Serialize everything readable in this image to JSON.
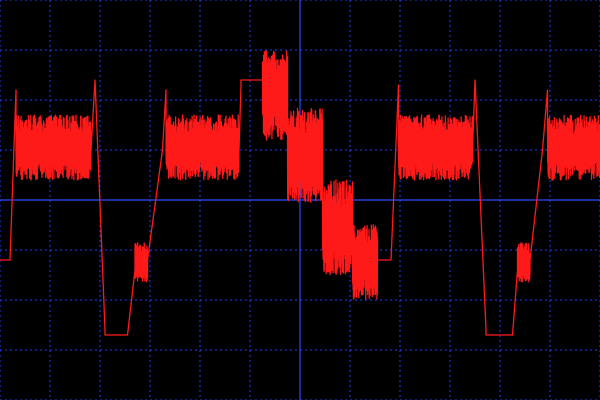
{
  "screen": {
    "background_color": "#000000",
    "grid_color": "#1f3fff",
    "axis_color": "#2a4bff",
    "trace_color": "#ff1a1a"
  },
  "chart_data": {
    "type": "line",
    "title": "",
    "xlabel": "",
    "ylabel": "",
    "grid": true,
    "grid_style": "dotted",
    "x_divisions": 12,
    "y_divisions": 8,
    "x_range": [
      0,
      12
    ],
    "y_range": [
      -4,
      4
    ],
    "series": [
      {
        "color": "#ff1a1a",
        "segments": [
          {
            "kind": "flat",
            "x0": 0.0,
            "x1": 0.2,
            "y": -1.2
          },
          {
            "kind": "ramp",
            "x0": 0.2,
            "x1": 0.32,
            "y0": -1.2,
            "y1": 2.2
          },
          {
            "kind": "noise",
            "x0": 0.32,
            "x1": 1.82,
            "center": 1.05,
            "amp": 0.65
          },
          {
            "kind": "ramp",
            "x0": 1.82,
            "x1": 1.9,
            "y0": 1.0,
            "y1": 2.4
          },
          {
            "kind": "ramp",
            "x0": 1.9,
            "x1": 2.1,
            "y0": 2.4,
            "y1": -2.6
          },
          {
            "kind": "flat",
            "x0": 2.1,
            "x1": 2.55,
            "y": -2.7
          },
          {
            "kind": "ramp",
            "x0": 2.55,
            "x1": 2.7,
            "y0": -2.7,
            "y1": -1.4
          },
          {
            "kind": "noise",
            "x0": 2.7,
            "x1": 2.95,
            "center": -1.25,
            "amp": 0.4
          },
          {
            "kind": "ramp",
            "x0": 2.95,
            "x1": 3.25,
            "y0": -1.2,
            "y1": 1.0
          },
          {
            "kind": "ramp",
            "x0": 3.25,
            "x1": 3.32,
            "y0": 1.0,
            "y1": 2.2
          },
          {
            "kind": "noise",
            "x0": 3.32,
            "x1": 4.78,
            "center": 1.05,
            "amp": 0.65
          },
          {
            "kind": "ramp",
            "x0": 4.78,
            "x1": 4.82,
            "y0": 1.0,
            "y1": 2.3
          },
          {
            "kind": "flat",
            "x0": 4.82,
            "x1": 5.25,
            "y": 2.4
          },
          {
            "kind": "noise",
            "x0": 5.25,
            "x1": 5.75,
            "center": 2.1,
            "amp": 0.9
          },
          {
            "kind": "noise",
            "x0": 5.75,
            "x1": 6.45,
            "center": 0.9,
            "amp": 0.95
          },
          {
            "kind": "noise",
            "x0": 6.45,
            "x1": 7.05,
            "center": -0.55,
            "amp": 0.95
          },
          {
            "kind": "noise",
            "x0": 7.05,
            "x1": 7.55,
            "center": -1.25,
            "amp": 0.75
          },
          {
            "kind": "flat",
            "x0": 7.55,
            "x1": 7.82,
            "y": -1.2
          },
          {
            "kind": "ramp",
            "x0": 7.82,
            "x1": 7.97,
            "y0": -1.2,
            "y1": 2.3
          },
          {
            "kind": "noise",
            "x0": 7.97,
            "x1": 9.45,
            "center": 1.05,
            "amp": 0.65
          },
          {
            "kind": "ramp",
            "x0": 9.45,
            "x1": 9.5,
            "y0": 1.0,
            "y1": 2.4
          },
          {
            "kind": "ramp",
            "x0": 9.5,
            "x1": 9.72,
            "y0": 2.4,
            "y1": -2.6
          },
          {
            "kind": "flat",
            "x0": 9.72,
            "x1": 10.25,
            "y": -2.7
          },
          {
            "kind": "ramp",
            "x0": 10.25,
            "x1": 10.35,
            "y0": -2.7,
            "y1": -1.4
          },
          {
            "kind": "noise",
            "x0": 10.35,
            "x1": 10.6,
            "center": -1.25,
            "amp": 0.4
          },
          {
            "kind": "ramp",
            "x0": 10.6,
            "x1": 10.85,
            "y0": -1.2,
            "y1": 1.0
          },
          {
            "kind": "ramp",
            "x0": 10.85,
            "x1": 10.95,
            "y0": 1.0,
            "y1": 2.2
          },
          {
            "kind": "noise",
            "x0": 10.95,
            "x1": 12.0,
            "center": 1.05,
            "amp": 0.65
          }
        ]
      }
    ]
  }
}
